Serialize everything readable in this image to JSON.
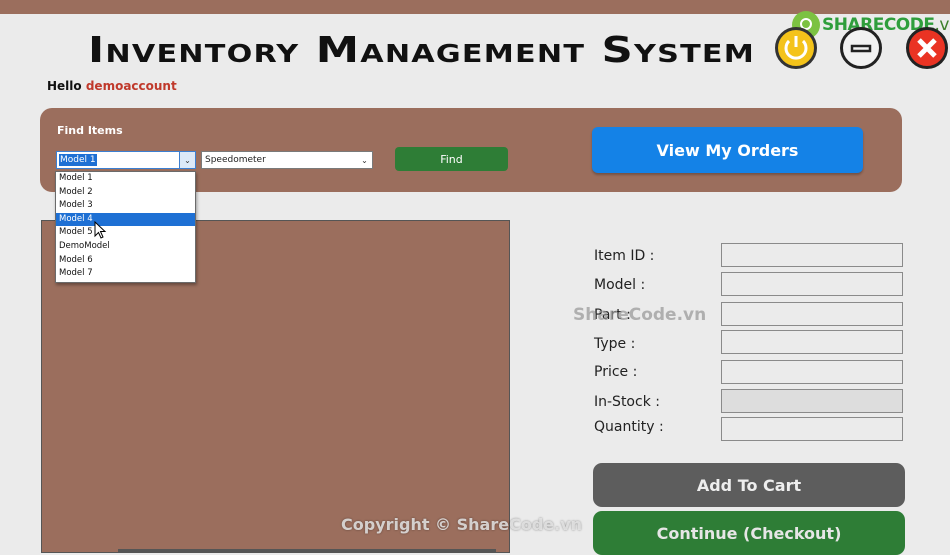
{
  "app": {
    "title": "Inventory Management System",
    "greeting": "Hello",
    "username": "demoaccount"
  },
  "logo": {
    "text_main": "SHARECODE",
    "text_suffix": ".vn"
  },
  "find": {
    "label": "Find Items",
    "model_value": "Model 1",
    "part_value": "Speedometer",
    "button_label": "Find",
    "model_options": [
      "Model 1",
      "Model 2",
      "Model 3",
      "Model 4",
      "Model 5",
      "DemoModel",
      "Model 6",
      "Model 7"
    ],
    "highlighted_option": "Model 4"
  },
  "orders": {
    "button_label": "View My Orders"
  },
  "details": {
    "item_id_label": "Item ID :",
    "model_label": "Model :",
    "part_label": "Part :",
    "type_label": "Type :",
    "price_label": "Price :",
    "instock_label": "In-Stock :",
    "quantity_label": "Quantity :",
    "item_id_value": "",
    "model_value": "",
    "part_value": "",
    "type_value": "",
    "price_value": "",
    "instock_value": "",
    "quantity_value": ""
  },
  "actions": {
    "add_to_cart_label": "Add To Cart",
    "checkout_label": "Continue (Checkout)"
  },
  "watermarks": {
    "center": "ShareCode.vn",
    "bottom": "Copyright © ShareCode.vn"
  },
  "colors": {
    "panel_brown": "#9b6e5d",
    "accent_blue": "#1482e7",
    "find_green": "#2e7d36",
    "cart_gray": "#5d5d5d",
    "username_red": "#c0392b"
  },
  "icons": [
    "power-icon",
    "minimize-icon",
    "close-icon",
    "chevron-down-icon",
    "mouse-cursor-icon",
    "sharecode-logo-icon"
  ]
}
